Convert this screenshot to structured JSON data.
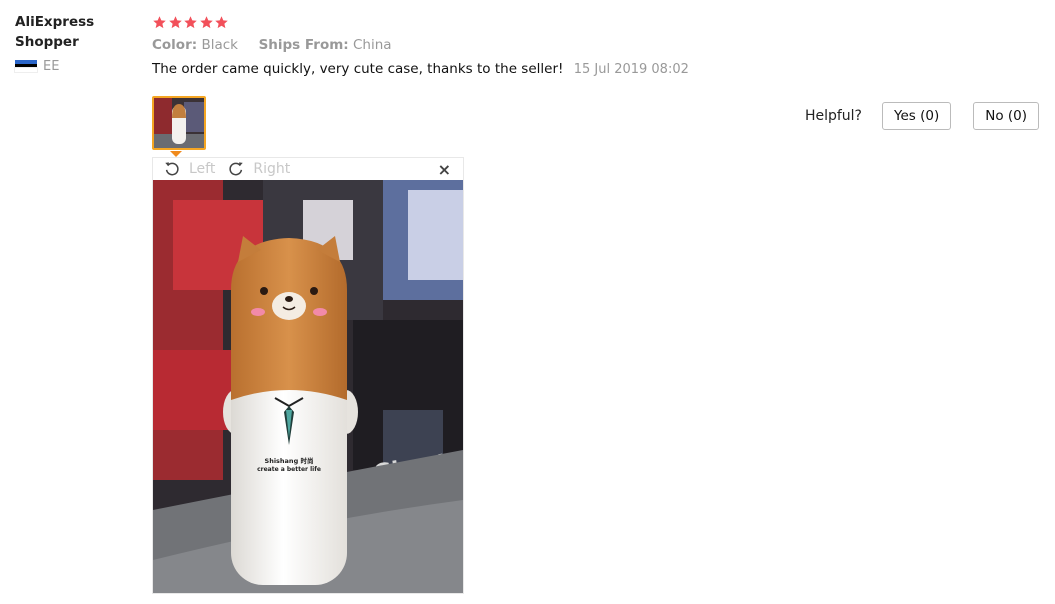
{
  "reviewer": {
    "name": "AliExpress Shopper",
    "country_code": "EE",
    "flag_colors": [
      "#2b66c9",
      "#000000",
      "#ffffff"
    ]
  },
  "review": {
    "rating": 5,
    "rating_max": 5,
    "star_color": "#f2505a",
    "attributes": [
      {
        "label": "Color:",
        "value": "Black"
      },
      {
        "label": "Ships From:",
        "value": "China"
      }
    ],
    "text": "The order came quickly, very cute case, thanks to the seller!",
    "date": "15 Jul 2019 08:02"
  },
  "viewer": {
    "rotate_left_label": "Left",
    "rotate_right_label": "Right",
    "close_glyph": "×"
  },
  "helpful": {
    "label": "Helpful?",
    "yes_label": "Yes (0)",
    "no_label": "No (0)"
  },
  "photo_print": {
    "line1": "Shishang 时尚",
    "line2": "create a better life",
    "poster_text": "Ghoul"
  },
  "icons": {
    "star": "star-icon",
    "rotate_left": "rotate-left-icon",
    "rotate_right": "rotate-right-icon",
    "close": "close-icon"
  }
}
